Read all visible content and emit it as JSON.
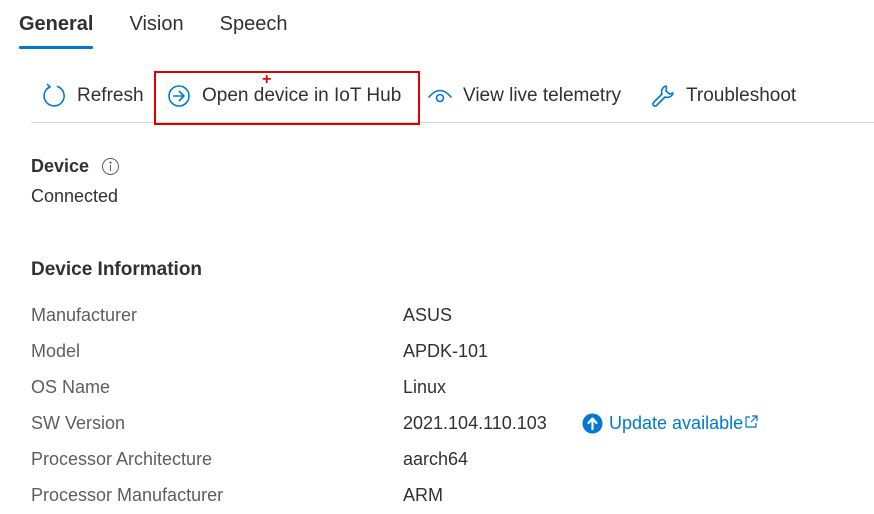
{
  "tabs": [
    {
      "label": "General",
      "active": true
    },
    {
      "label": "Vision",
      "active": false
    },
    {
      "label": "Speech",
      "active": false
    }
  ],
  "toolbar": {
    "refresh_label": "Refresh",
    "refresh_icon": "refresh-icon",
    "open_label": "Open device in IoT Hub",
    "open_icon": "arrow-circle-right-icon",
    "telemetry_label": "View live telemetry",
    "telemetry_icon": "eye-icon",
    "troubleshoot_label": "Troubleshoot",
    "troubleshoot_icon": "wrench-icon"
  },
  "device": {
    "label": "Device",
    "info_icon": "info-icon",
    "status": "Connected"
  },
  "device_information": {
    "title": "Device Information",
    "properties": [
      {
        "name": "Manufacturer",
        "value": "ASUS"
      },
      {
        "name": "Model",
        "value": "APDK-101"
      },
      {
        "name": "OS Name",
        "value": "Linux"
      },
      {
        "name": "SW Version",
        "value": "2021.104.110.103"
      },
      {
        "name": "Processor Architecture",
        "value": "aarch64"
      },
      {
        "name": "Processor Manufacturer",
        "value": "ARM"
      }
    ],
    "update_link": {
      "label": "Update available",
      "icon": "arrow-up-circle-icon",
      "external_icon": "external-link-icon"
    }
  },
  "colors": {
    "accent": "#0078d4",
    "highlight": "#e00000",
    "text": "#323130",
    "label": "#605e5c"
  }
}
